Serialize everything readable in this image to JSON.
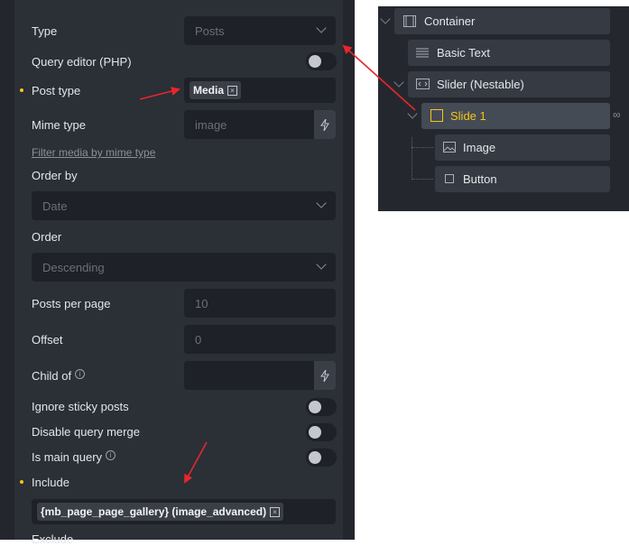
{
  "panel": {
    "type": {
      "label": "Type",
      "value": "Posts"
    },
    "query_editor": {
      "label": "Query editor (PHP)"
    },
    "post_type": {
      "label": "Post type",
      "tag": "Media"
    },
    "mime_type": {
      "label": "Mime type",
      "placeholder": "image"
    },
    "filter_link": "Filter media by mime type",
    "order_by": {
      "label": "Order by",
      "value": "Date"
    },
    "order": {
      "label": "Order",
      "value": "Descending"
    },
    "posts_per_page": {
      "label": "Posts per page",
      "placeholder": "10"
    },
    "offset": {
      "label": "Offset",
      "placeholder": "0"
    },
    "child_of": {
      "label": "Child of"
    },
    "ignore_sticky": {
      "label": "Ignore sticky posts"
    },
    "disable_merge": {
      "label": "Disable query merge"
    },
    "is_main_query": {
      "label": "Is main query"
    },
    "include": {
      "label": "Include",
      "tag": "{mb_page_page_gallery} (image_advanced)"
    },
    "exclude": {
      "label": "Exclude"
    },
    "remove_glyph": "×",
    "info_glyph": "i"
  },
  "tree": {
    "container": "Container",
    "basic_text": "Basic Text",
    "slider": "Slider (Nestable)",
    "slide": "Slide 1",
    "image": "Image",
    "button": "Button",
    "link_glyph": "∞"
  },
  "colors": {
    "accent": "#f5c518",
    "arrow": "#e8262b"
  }
}
